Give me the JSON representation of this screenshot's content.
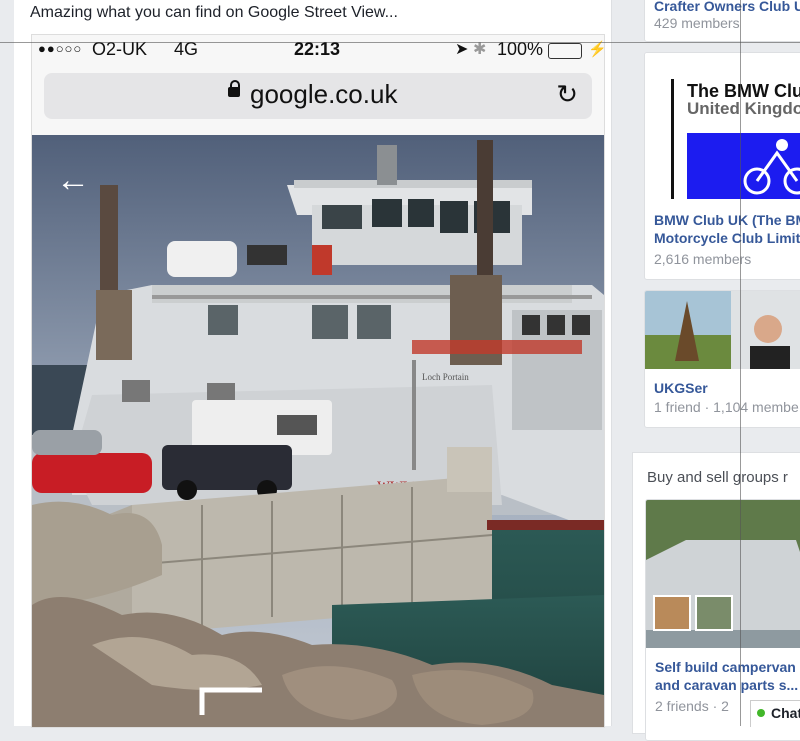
{
  "post": {
    "caption": "Amazing what you can find on Google Street View..."
  },
  "phone": {
    "signal": "●●○○○",
    "carrier": "O2-UK",
    "network": "4G",
    "time": "22:13",
    "battery_pct": "100%",
    "battery_level": 1.0,
    "url": "google.co.uk",
    "ferry_hull_text": "www.co       .co.uk",
    "ferry_name_text": "Loch Portain"
  },
  "sidebar": {
    "groups": [
      {
        "title": "Crafter Owners Club U",
        "meta": "429 members"
      },
      {
        "logo_line1": "The BMW Clu",
        "logo_line2": "United Kingdo",
        "title_line1": "BMW Club UK (The BM",
        "title_line2": "Motorcycle Club Limit",
        "meta": "2,616 members"
      },
      {
        "title": "UKGSer",
        "meta": "1 friend · 1,104 membe"
      }
    ],
    "section_heading": "Buy and sell groups r",
    "sale_group": {
      "title_line1": "Self build campervan",
      "title_line2": "and caravan parts s...",
      "meta": "2 friends · 2"
    }
  },
  "chat": {
    "label": "Chat"
  },
  "colors": {
    "link": "#365899",
    "battery": "#34c759",
    "bmw_blue": "#1c1cf0"
  }
}
